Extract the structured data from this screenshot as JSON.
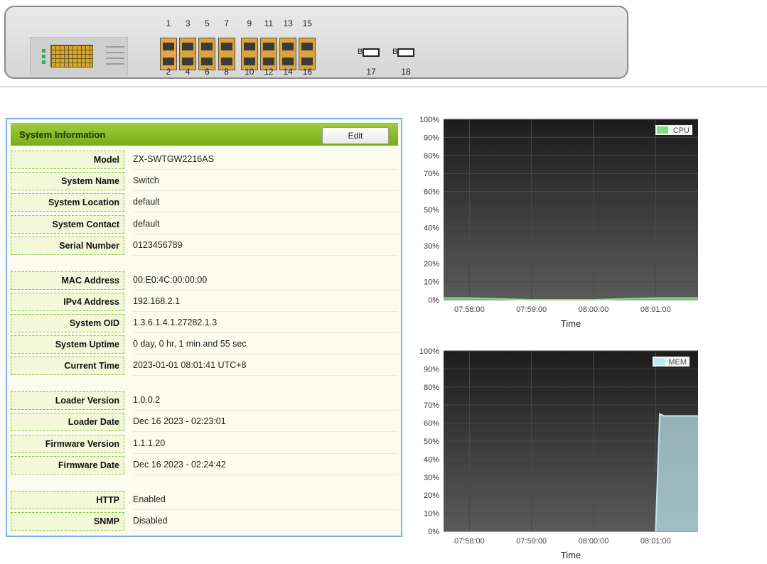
{
  "panel": {
    "ports_top": [
      "1",
      "3",
      "5",
      "7",
      "9",
      "11",
      "13",
      "15"
    ],
    "ports_bottom": [
      "2",
      "4",
      "6",
      "8",
      "10",
      "12",
      "14",
      "16"
    ],
    "sfp_ports": [
      "17",
      "18"
    ],
    "sfp_prefix": "B",
    "colors": {
      "port": "#d9a53a",
      "port_link": "#e8a446",
      "led": "#2fb34a"
    }
  },
  "system_info": {
    "title": "System Information",
    "edit_label": "Edit",
    "rows": [
      {
        "label": "Model",
        "value": "ZX-SWTGW2216AS"
      },
      {
        "label": "System Name",
        "value": "Switch"
      },
      {
        "label": "System Location",
        "value": "default"
      },
      {
        "label": "System Contact",
        "value": "default"
      },
      {
        "label": "Serial Number",
        "value": "0123456789"
      },
      {
        "label": "MAC Address",
        "value": "00:E0:4C:00:00:00"
      },
      {
        "label": "IPv4 Address",
        "value": "192.168.2.1"
      },
      {
        "label": "System OID",
        "value": "1.3.6.1.4.1.27282.1.3"
      },
      {
        "label": "System Uptime",
        "value": "0 day, 0 hr, 1 min and 55 sec"
      },
      {
        "label": "Current Time",
        "value": "2023-01-01 08:01:41 UTC+8"
      },
      {
        "label": "Loader Version",
        "value": "1.0.0.2"
      },
      {
        "label": "Loader Date",
        "value": "Dec 16 2023 - 02:23:01"
      },
      {
        "label": "Firmware Version",
        "value": "1.1.1.20"
      },
      {
        "label": "Firmware Date",
        "value": "Dec 16 2023 - 02:24:42"
      },
      {
        "label": "HTTP",
        "value": "Enabled"
      },
      {
        "label": "SNMP",
        "value": "Disabled"
      }
    ],
    "colors": {
      "header": "#8cc43d",
      "border": "#7aaee6"
    }
  },
  "chart_data": [
    {
      "type": "area",
      "xlabel": "Time",
      "x_ticks": [
        "07:58:00",
        "07:59:00",
        "08:00:00",
        "08:01:00"
      ],
      "y_ticks": [
        "0%",
        "10%",
        "20%",
        "30%",
        "40%",
        "50%",
        "60%",
        "70%",
        "80%",
        "90%",
        "100%"
      ],
      "ylim": [
        0,
        100
      ],
      "xlim": [
        "07:57:35",
        "08:01:41"
      ],
      "grid": true,
      "legend": "top-right",
      "series": [
        {
          "name": "CPU",
          "color": "#7ee07e",
          "x": [
            "07:57:35",
            "07:58:00",
            "07:59:00",
            "08:00:00",
            "08:01:00",
            "08:01:41"
          ],
          "values": [
            1,
            1,
            0,
            0,
            1,
            1
          ]
        }
      ]
    },
    {
      "type": "area",
      "xlabel": "Time",
      "x_ticks": [
        "07:58:00",
        "07:59:00",
        "08:00:00",
        "08:01:00"
      ],
      "y_ticks": [
        "0%",
        "10%",
        "20%",
        "30%",
        "40%",
        "50%",
        "60%",
        "70%",
        "80%",
        "90%",
        "100%"
      ],
      "ylim": [
        0,
        100
      ],
      "xlim": [
        "07:57:35",
        "08:01:41"
      ],
      "grid": true,
      "legend": "top-right",
      "series": [
        {
          "name": "MEM",
          "color": "#bfe8f0",
          "x": [
            "08:01:00",
            "08:01:04",
            "08:01:08",
            "08:01:41"
          ],
          "values": [
            0,
            65,
            64,
            64
          ]
        }
      ]
    }
  ]
}
